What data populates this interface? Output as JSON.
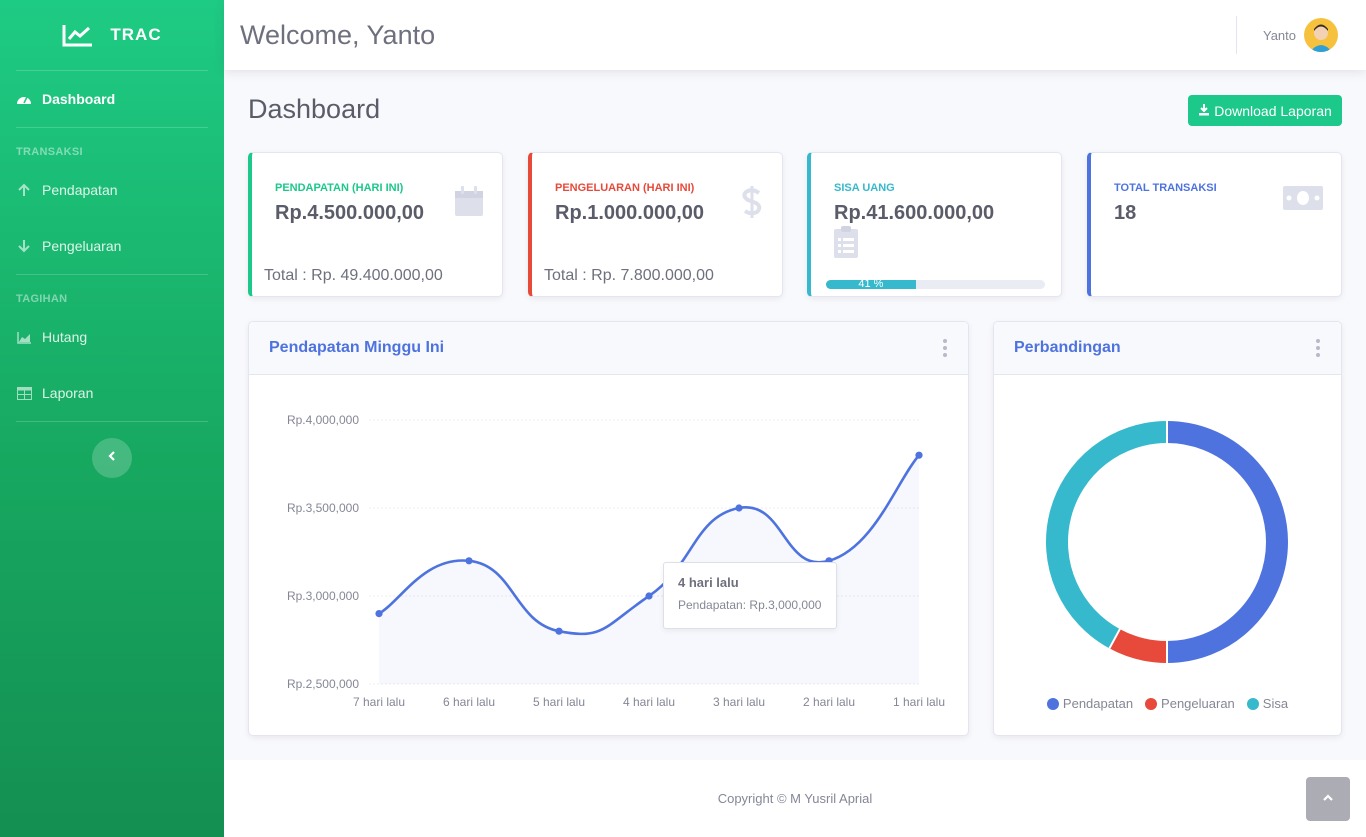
{
  "sidebar": {
    "brand": "TRAC",
    "dashboard": "Dashboard",
    "heading_transaksi": "TRANSAKSI",
    "pendapatan": "Pendapatan",
    "pengeluaran": "Pengeluaran",
    "heading_tagihan": "TAGIHAN",
    "hutang": "Hutang",
    "laporan": "Laporan"
  },
  "topbar": {
    "welcome": "Welcome, Yanto",
    "user": "Yanto"
  },
  "page": {
    "title": "Dashboard",
    "download_label": "Download Laporan"
  },
  "cards": {
    "pendapatan": {
      "label": "PENDAPATAN (HARI INI)",
      "value": "Rp.4.500.000,00",
      "total": "Total : Rp. 49.400.000,00",
      "color": "#1cc88a"
    },
    "pengeluaran": {
      "label": "PENGELUARAN (HARI INI)",
      "value": "Rp.1.000.000,00",
      "total": "Total : Rp. 7.800.000,00",
      "color": "#e74a3b"
    },
    "sisa": {
      "label": "SISA UANG",
      "value": "Rp.41.600.000,00",
      "progress_label": "41 %",
      "progress": 41,
      "color": "#36b9cc"
    },
    "transaksi": {
      "label": "TOTAL TRANSAKSI",
      "value": "18",
      "color": "#4e73df"
    }
  },
  "line_panel": {
    "title": "Pendapatan Minggu Ini"
  },
  "pie_panel": {
    "title": "Perbandingan"
  },
  "tooltip": {
    "title": "4 hari lalu",
    "body": "Pendapatan: Rp.3,000,000"
  },
  "chart_data": [
    {
      "type": "line",
      "categories": [
        "7 hari lalu",
        "6 hari lalu",
        "5 hari lalu",
        "4 hari lalu",
        "3 hari lalu",
        "2 hari lalu",
        "1 hari lalu"
      ],
      "series": [
        {
          "name": "Pendapatan",
          "values": [
            2900000,
            3200000,
            2800000,
            3000000,
            3500000,
            3200000,
            3800000
          ]
        }
      ],
      "ylim": [
        2500000,
        4000000
      ],
      "yticks": [
        2500000,
        3000000,
        3500000,
        4000000
      ],
      "ytick_labels": [
        "Rp.2,500,000",
        "Rp.3,000,000",
        "Rp.3,500,000",
        "Rp.4,000,000"
      ],
      "color": "#4e73df"
    },
    {
      "type": "pie",
      "labels": [
        "Pendapatan",
        "Pengeluaran",
        "Sisa"
      ],
      "values": [
        49400000,
        7800000,
        41600000
      ],
      "colors": [
        "#4e73df",
        "#e74a3b",
        "#36b9cc"
      ]
    }
  ],
  "footer": {
    "copyright": "Copyright © M Yusril Aprial"
  }
}
